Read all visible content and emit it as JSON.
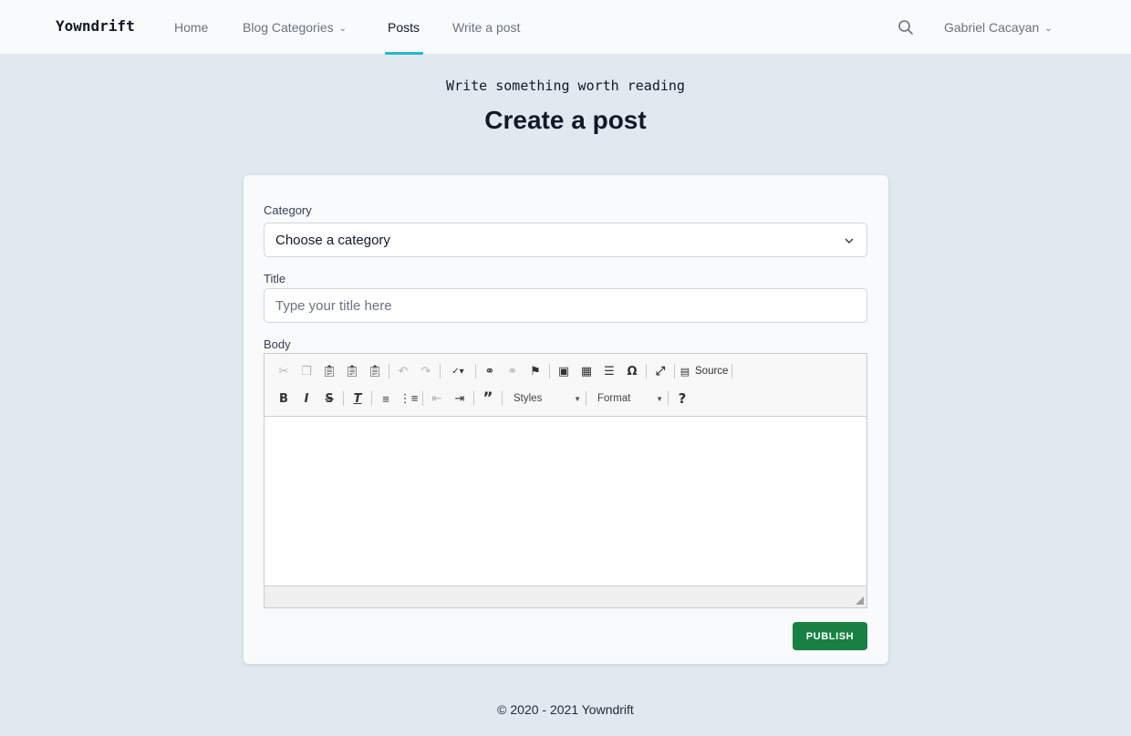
{
  "navbar": {
    "brand": "Yowndrift",
    "links": [
      {
        "label": "Home"
      },
      {
        "label": "Blog Categories"
      },
      {
        "label": "Posts"
      },
      {
        "label": "Write a post"
      }
    ],
    "active_link": "Posts",
    "user_name": "Gabriel Cacayan"
  },
  "header": {
    "tagline": "Write something worth reading",
    "title": "Create a post"
  },
  "form": {
    "category": {
      "label": "Category",
      "selected": "Choose a category"
    },
    "title": {
      "label": "Title",
      "placeholder": "Type your title here"
    },
    "body": {
      "label": "Body"
    },
    "submit_label": "PUBLISH"
  },
  "editor_toolbar": {
    "source_label": "Source",
    "styles_label": "Styles",
    "format_label": "Format",
    "row1_icons": [
      "cut-icon",
      "copy-icon",
      "paste-icon",
      "paste-text-icon",
      "paste-from-word-icon",
      "undo-icon",
      "redo-icon",
      "spellcheck-icon",
      "link-icon",
      "unlink-icon",
      "anchor-icon",
      "image-icon",
      "table-icon",
      "horizontal-line-icon",
      "special-char-icon",
      "maximize-icon",
      "source-icon"
    ],
    "row2_icons": [
      "bold-icon",
      "italic-icon",
      "strike-icon",
      "remove-format-icon",
      "numbered-list-icon",
      "bulleted-list-icon",
      "outdent-icon",
      "indent-icon",
      "blockquote-icon",
      "help-icon"
    ]
  },
  "footer": {
    "text": "© 2020 - 2021 Yowndrift"
  },
  "colors": {
    "page_bg": "#e2e8f0",
    "navbar_bg": "#f8fafc",
    "active_underline": "#22b8cf",
    "publish_button": "#198044"
  }
}
